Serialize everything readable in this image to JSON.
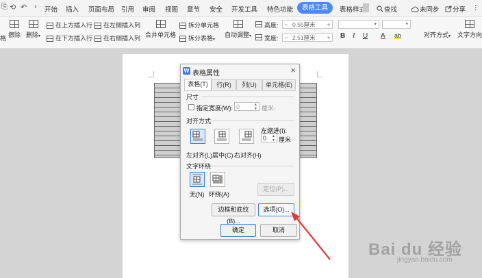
{
  "menubar": {
    "quick_access": [
      "⎘",
      "⟲",
      "↶",
      "›"
    ],
    "items": [
      "开始",
      "插入",
      "页面布局",
      "引用",
      "审阅",
      "视图",
      "章节",
      "安全",
      "开发工具",
      "特色功能"
    ],
    "active_tab": "表格工具",
    "extra_tab": "表格样式",
    "search": "查找",
    "sync": "未同步",
    "share": "分享"
  },
  "ribbon": {
    "left_clip": "格",
    "erase": "擦除",
    "delete": "删除",
    "insert_above": "在上方插入行",
    "insert_below": "在下方插入行",
    "insert_left": "在左侧插入列",
    "insert_right": "在右侧插入列",
    "merge_cells": "合并单元格",
    "split_cells": "拆分单元格",
    "split_table": "拆分表格",
    "autofit": "自动调整",
    "height_label": "高度:",
    "height_value": "0.55厘米",
    "width_label": "宽度:",
    "width_value": "2.51厘米",
    "bold": "B",
    "italic": "I",
    "underline": "U",
    "font_color": "A",
    "highlight": "ab",
    "align": "对齐方式",
    "text_direction": "文字方向"
  },
  "dialog": {
    "title": "表格属性",
    "icon_glyph": "W",
    "close": "×",
    "tabs": [
      "表格(T)",
      "行(R)",
      "列(U)",
      "单元格(E)"
    ],
    "size_section": "尺寸",
    "specify_width": "指定宽度(W):",
    "width_value": "0",
    "width_unit": "厘米·",
    "alignment_section": "对齐方式",
    "left_indent_label": "左缩进(I):",
    "left_indent_value": "0",
    "left_indent_unit": "厘米·",
    "align_left": "左对齐(L)",
    "align_center": "居中(C)",
    "align_right": "右对齐(H)",
    "wrap_section": "文字环绕",
    "wrap_none": "无(N)",
    "wrap_around": "环绕(A)",
    "positioning": "定位(P)...",
    "borders_shading": "边框和底纹(B)...",
    "options": "选项(O)...",
    "ok": "确定",
    "cancel": "取消"
  },
  "watermark": {
    "brand": "Bai du 经验",
    "url": "jingyan.baidu.com"
  },
  "colors": {
    "accent": "#4d88ff",
    "arrow": "#e53935"
  }
}
